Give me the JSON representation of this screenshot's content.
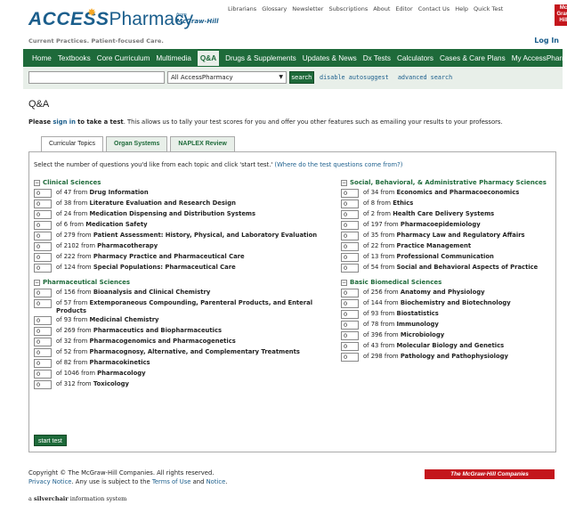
{
  "header": {
    "logo_access": "ACCESS",
    "logo_pharmacy": "Pharmacy",
    "logo_from": "from",
    "logo_mh": "McGraw-Hill",
    "tagline": "Current Practices. Patient-focused Care.",
    "top_links": [
      "Librarians",
      "Glossary",
      "Newsletter",
      "Subscriptions",
      "About",
      "Editor",
      "Contact Us",
      "Help",
      "Quick Test"
    ],
    "mh_badge": "Mc Graw Hill",
    "login": "Log In"
  },
  "nav": {
    "items": [
      "Home",
      "Textbooks",
      "Core Curriculum",
      "Multimedia",
      "Q&A",
      "Drugs & Supplements",
      "Updates & News",
      "Dx Tests",
      "Calculators",
      "Cases & Care Plans",
      "My AccessPharmacy"
    ],
    "active_index": 4
  },
  "search": {
    "input_value": "",
    "select_value": "All AccessPharmacy",
    "button_label": "search",
    "links": [
      "disable autosuggest",
      "advanced search"
    ]
  },
  "page": {
    "title": "Q&A",
    "intro_prefix": "Please",
    "intro_link": "sign in",
    "intro_mid": "to take a test",
    "intro_suffix": ". This allows us to tally your test scores for you and offer you other features such as emailing your results to your professors.",
    "tabs": [
      "Curricular Topics",
      "Organ Systems",
      "NAPLEX Review"
    ],
    "active_tab": 0,
    "instructions": "Select the number of questions you'd like from each topic and click 'start test.'",
    "instructions_link": "(Where do the test questions come from?)",
    "start_button": "start test"
  },
  "categories_left": [
    {
      "name": "Clinical Sciences",
      "topics": [
        {
          "value": "0",
          "count": "of 47 from",
          "name": "Drug Information"
        },
        {
          "value": "0",
          "count": "of 38 from",
          "name": "Literature Evaluation and Research Design"
        },
        {
          "value": "0",
          "count": "of 24 from",
          "name": "Medication Dispensing and Distribution Systems"
        },
        {
          "value": "0",
          "count": "of 6 from",
          "name": "Medication Safety"
        },
        {
          "value": "0",
          "count": "of 279 from",
          "name": "Patient Assessment: History, Physical, and Laboratory Evaluation"
        },
        {
          "value": "0",
          "count": "of 2102 from",
          "name": "Pharmacotherapy"
        },
        {
          "value": "0",
          "count": "of 222 from",
          "name": "Pharmacy Practice and Pharmaceutical Care"
        },
        {
          "value": "0",
          "count": "of 124 from",
          "name": "Special Populations: Pharmaceutical Care"
        }
      ]
    },
    {
      "name": "Pharmaceutical Sciences",
      "topics": [
        {
          "value": "0",
          "count": "of 156 from",
          "name": "Bioanalysis and Clinical Chemistry"
        },
        {
          "value": "0",
          "count": "of 57 from",
          "name": "Extemporaneous Compounding, Parenteral Products, and Enteral Products"
        },
        {
          "value": "0",
          "count": "of 93 from",
          "name": "Medicinal Chemistry"
        },
        {
          "value": "0",
          "count": "of 269 from",
          "name": "Pharmaceutics and Biopharmaceutics"
        },
        {
          "value": "0",
          "count": "of 32 from",
          "name": "Pharmacogenomics and Pharmacogenetics"
        },
        {
          "value": "0",
          "count": "of 52 from",
          "name": "Pharmacognosy, Alternative, and Complementary Treatments"
        },
        {
          "value": "0",
          "count": "of 82 from",
          "name": "Pharmacokinetics"
        },
        {
          "value": "0",
          "count": "of 1046 from",
          "name": "Pharmacology"
        },
        {
          "value": "0",
          "count": "of 312 from",
          "name": "Toxicology"
        }
      ]
    }
  ],
  "categories_right": [
    {
      "name": "Social, Behavioral, & Administrative Pharmacy Sciences",
      "topics": [
        {
          "value": "0",
          "count": "of 34 from",
          "name": "Economics and Pharmacoeconomics"
        },
        {
          "value": "0",
          "count": "of 8 from",
          "name": "Ethics"
        },
        {
          "value": "0",
          "count": "of 2 from",
          "name": "Health Care Delivery Systems"
        },
        {
          "value": "0",
          "count": "of 197 from",
          "name": "Pharmacoepidemiology"
        },
        {
          "value": "0",
          "count": "of 35 from",
          "name": "Pharmacy Law and Regulatory Affairs"
        },
        {
          "value": "0",
          "count": "of 22 from",
          "name": "Practice Management"
        },
        {
          "value": "0",
          "count": "of 13 from",
          "name": "Professional Communication"
        },
        {
          "value": "0",
          "count": "of 54 from",
          "name": "Social and Behavioral Aspects of Practice"
        }
      ]
    },
    {
      "name": "Basic Biomedical Sciences",
      "topics": [
        {
          "value": "0",
          "count": "of 256 from",
          "name": "Anatomy and Physiology"
        },
        {
          "value": "0",
          "count": "of 144 from",
          "name": "Biochemistry and Biotechnology"
        },
        {
          "value": "0",
          "count": "of 93 from",
          "name": "Biostatistics"
        },
        {
          "value": "0",
          "count": "of 78 from",
          "name": "Immunology"
        },
        {
          "value": "0",
          "count": "of 396 from",
          "name": "Microbiology"
        },
        {
          "value": "0",
          "count": "of 43 from",
          "name": "Molecular Biology and Genetics"
        },
        {
          "value": "0",
          "count": "of 298 from",
          "name": "Pathology and Pathophysiology"
        }
      ]
    }
  ],
  "footer": {
    "copyright": "Copyright © The McGraw-Hill Companies. All rights reserved.",
    "privacy_link": "Privacy Notice",
    "privacy_mid": ". Any use is subject to the",
    "terms_link": "Terms of Use",
    "and": "and",
    "notice_link": "Notice",
    "period": ".",
    "mh_bar": "The McGraw·Hill Companies",
    "silverchair_a": "a",
    "silverchair_b": "silverchair",
    "silverchair_c": "information system"
  },
  "colors": {
    "nav_green": "#1e6a3a",
    "brand_blue": "#1b5e8c",
    "mh_red": "#c4161c"
  }
}
